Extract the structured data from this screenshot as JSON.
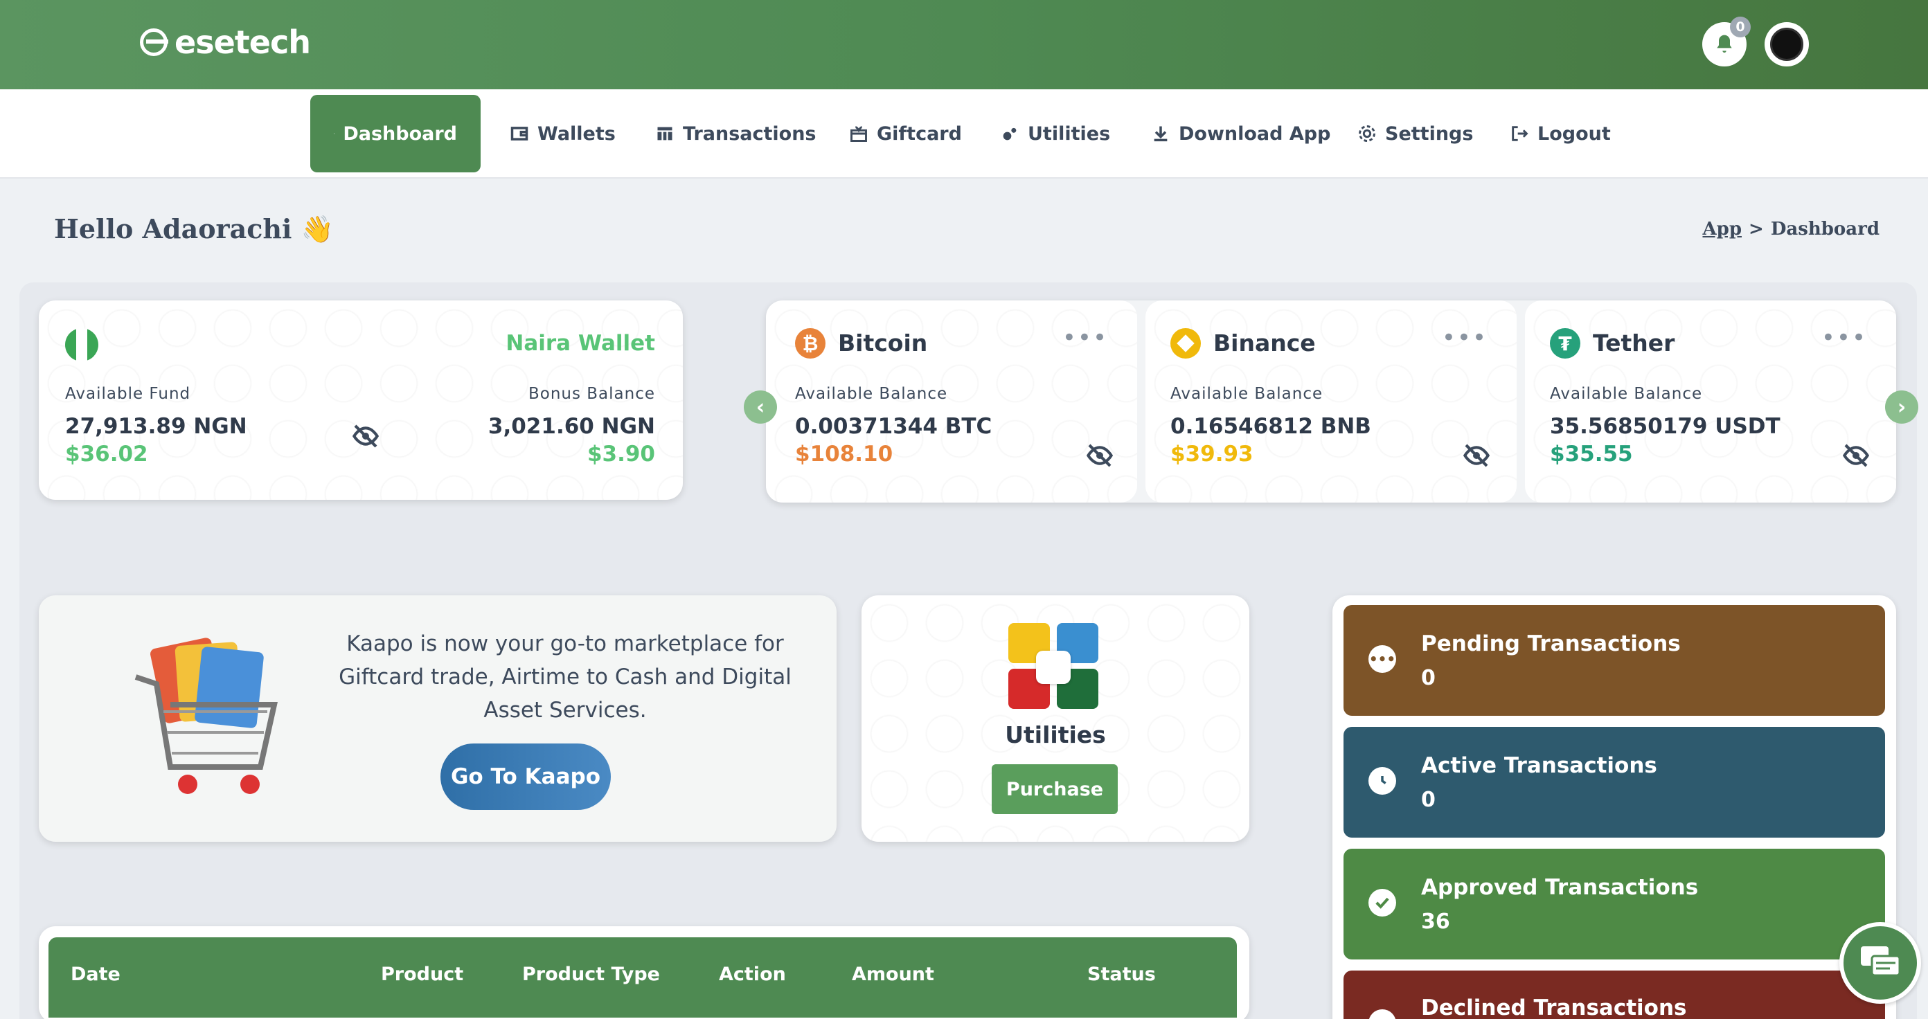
{
  "brand": {
    "name": "esetech"
  },
  "header": {
    "notification_count": "0"
  },
  "nav": [
    {
      "label": "Dashboard",
      "icon": "dashboard-icon",
      "active": true
    },
    {
      "label": "Wallets",
      "icon": "wallet-icon"
    },
    {
      "label": "Transactions",
      "icon": "table-icon"
    },
    {
      "label": "Giftcard",
      "icon": "giftcard-icon"
    },
    {
      "label": "Utilities",
      "icon": "utilities-icon"
    },
    {
      "label": "Download App",
      "icon": "download-icon"
    },
    {
      "label": "Settings",
      "icon": "gear-icon"
    },
    {
      "label": "Logout",
      "icon": "logout-icon"
    }
  ],
  "greeting": {
    "text": "Hello Adaorachi",
    "emoji": "👋"
  },
  "breadcrumb": {
    "root": "App",
    "separator": ">",
    "current": "Dashboard"
  },
  "naira_wallet": {
    "title": "Naira Wallet",
    "available_label": "Available Fund",
    "available_amount": "27,913.89 NGN",
    "available_usd": "$36.02",
    "bonus_label": "Bonus Balance",
    "bonus_amount": "3,021.60 NGN",
    "bonus_usd": "$3.90"
  },
  "coins": [
    {
      "name": "Bitcoin",
      "label": "Available Balance",
      "amount": "0.00371344 BTC",
      "usd": "$108.10",
      "color": "#e8833a",
      "icon": "bitcoin-icon"
    },
    {
      "name": "Binance",
      "label": "Available Balance",
      "amount": "0.16546812 BNB",
      "usd": "$39.93",
      "color": "#f0b90b",
      "icon": "binance-icon"
    },
    {
      "name": "Tether",
      "label": "Available Balance",
      "amount": "35.56850179 USDT",
      "usd": "$35.55",
      "color": "#26a17b",
      "icon": "tether-icon"
    }
  ],
  "kaapo": {
    "text": "Kaapo is now your go-to marketplace for Giftcard trade, Airtime to Cash and Digital Asset Services.",
    "button": "Go To Kaapo"
  },
  "utilities_card": {
    "title": "Utilities",
    "button": "Purchase"
  },
  "status": [
    {
      "title": "Pending Transactions",
      "count": "0",
      "color": "#7d5428",
      "icon": "ellipsis-icon"
    },
    {
      "title": "Active Transactions",
      "count": "0",
      "color": "#2e5a6e",
      "icon": "clock-icon"
    },
    {
      "title": "Approved Transactions",
      "count": "36",
      "color": "#4e8a45",
      "icon": "check-circle-icon"
    },
    {
      "title": "Declined Transactions",
      "count": "",
      "color": "#7a2a22",
      "icon": "close-circle-icon"
    }
  ],
  "table": {
    "columns": [
      "Date",
      "Product",
      "Product Type",
      "Action",
      "Amount",
      "Status"
    ]
  }
}
